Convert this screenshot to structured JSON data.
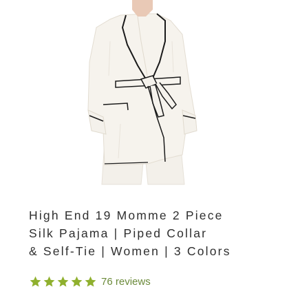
{
  "product": {
    "image_icon": "product-photo-silk-pajama-robe",
    "title_lines": [
      "High End 19 Momme 2 Piece",
      "Silk Pajama | Piped Collar",
      "& Self-Tie | Women | 3 Colors"
    ],
    "rating": {
      "stars": 5,
      "star_icon": "star-icon",
      "reviews_text": "76 reviews"
    }
  },
  "colors": {
    "star": "#8fb02e",
    "reviews_link": "#6b8a3a",
    "title_text": "#2f2f2f",
    "piping": "#1a1a1a",
    "silk": "#f5f2ec"
  }
}
